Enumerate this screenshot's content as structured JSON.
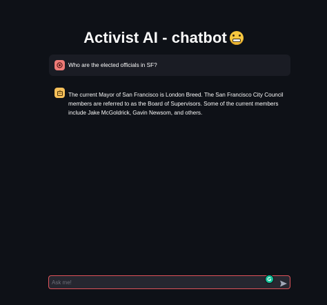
{
  "page": {
    "title": "Activist AI - chatbot"
  },
  "messages": [
    {
      "role": "user",
      "text": "Who are the elected officials in SF?"
    },
    {
      "role": "assistant",
      "text": "The current Mayor of San Francisco is London Breed. The San Francisco City Council members are referred to as the Board of Supervisors. Some of the current members include Jake McGoldrick, Gavin Newsom, and others."
    }
  ],
  "chat_input": {
    "value": "",
    "placeholder": "Ask me!"
  },
  "colors": {
    "background": "#0e1117",
    "user_message_bg": "#1a1c24",
    "user_avatar": "#ef7b77",
    "assistant_avatar": "#f6c05a",
    "input_border": "#e0535a",
    "input_bg": "#262730"
  },
  "icons": {
    "title_emoji": "grimacing-face-icon",
    "user_avatar": "user-face-icon",
    "assistant_avatar": "robot-face-icon",
    "send": "send-icon",
    "input_extension": "grammarly-icon"
  }
}
